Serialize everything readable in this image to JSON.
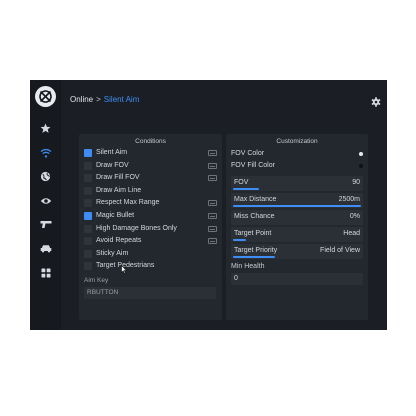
{
  "header": {
    "breadcrumb_root": "Online",
    "breadcrumb_separator": ">",
    "breadcrumb_current": "Silent Aim"
  },
  "sidebar": {
    "items": [
      {
        "icon": "star-icon"
      },
      {
        "icon": "wifi-icon",
        "active": true
      },
      {
        "icon": "globe-icon"
      },
      {
        "icon": "eye-icon"
      },
      {
        "icon": "gun-icon"
      },
      {
        "icon": "car-icon"
      },
      {
        "icon": "grid-icon"
      }
    ]
  },
  "conditions": {
    "title": "Conditions",
    "items": [
      {
        "label": "Silent Aim",
        "checked": true,
        "hotkey": true
      },
      {
        "label": "Draw FOV",
        "checked": false,
        "hotkey": true
      },
      {
        "label": "Draw Fill FOV",
        "checked": false,
        "hotkey": true
      },
      {
        "label": "Draw Aim Line",
        "checked": false,
        "hotkey": false
      },
      {
        "label": "Respect Max Range",
        "checked": false,
        "hotkey": true
      },
      {
        "label": "Magic Bullet",
        "checked": true,
        "hotkey": true
      },
      {
        "label": "High Damage Bones Only",
        "checked": false,
        "hotkey": true
      },
      {
        "label": "Avoid Repeats",
        "checked": false,
        "hotkey": true
      },
      {
        "label": "Sticky Aim",
        "checked": false,
        "hotkey": false
      },
      {
        "label": "Target Pedestrians",
        "checked": false,
        "hotkey": false
      }
    ],
    "aim_key_label": "Aim Key",
    "aim_key_value": "RBUTTON"
  },
  "customization": {
    "title": "Customization",
    "fov_color_label": "FOV Color",
    "fov_fill_color_label": "FOV Fill Color",
    "fov_color": "#e8e8e8",
    "fov_fill_color": "#111111",
    "accent_color": "#3d8df5",
    "sliders": [
      {
        "label": "FOV",
        "value": "90",
        "fill": 0.2
      },
      {
        "label": "Max Distance",
        "value": "2500m",
        "fill": 1.0
      },
      {
        "label": "Miss Chance",
        "value": "0%",
        "fill": 0.0
      },
      {
        "label": "Target Point",
        "value": "Head",
        "fill": 0.1
      },
      {
        "label": "Target Priority",
        "value": "Field of View",
        "fill": 0.33
      }
    ],
    "min_health_label": "Min Health",
    "min_health_value": "0"
  }
}
